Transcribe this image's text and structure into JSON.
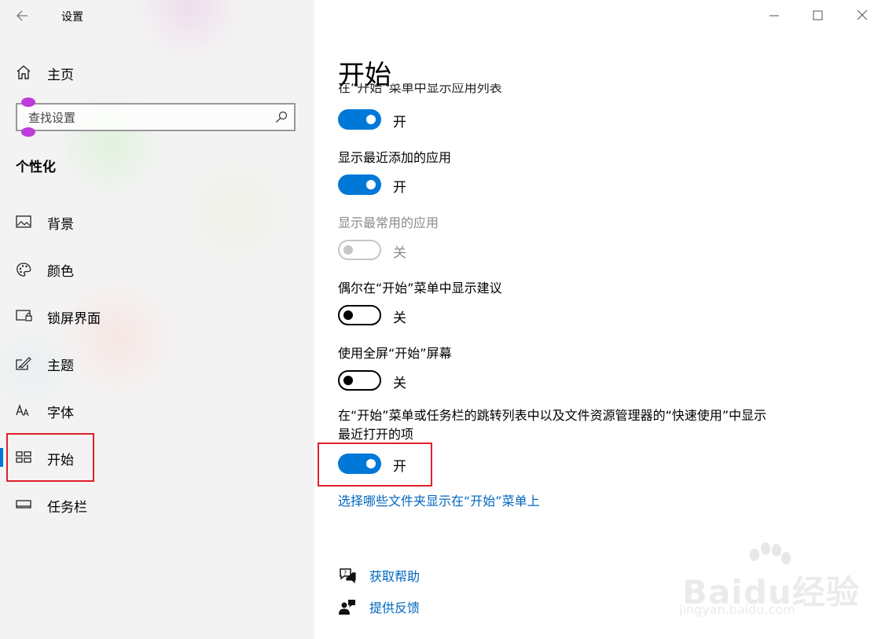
{
  "app": {
    "title": "设置"
  },
  "sidebar": {
    "home_label": "主页",
    "search_placeholder": "查找设置",
    "section_title": "个性化",
    "items": [
      {
        "label": "背景",
        "icon": "image-icon"
      },
      {
        "label": "颜色",
        "icon": "palette-icon"
      },
      {
        "label": "锁屏界面",
        "icon": "lock-screen-icon"
      },
      {
        "label": "主题",
        "icon": "theme-icon"
      },
      {
        "label": "字体",
        "icon": "font-icon"
      },
      {
        "label": "开始",
        "icon": "start-icon",
        "selected": true
      },
      {
        "label": "任务栏",
        "icon": "taskbar-icon"
      }
    ]
  },
  "main": {
    "title": "开始",
    "clipped_label": "在“开始”菜单中显示应用列表",
    "options": [
      {
        "label": "",
        "state": "开",
        "on": true,
        "enabled": true
      },
      {
        "label": "显示最近添加的应用",
        "state": "开",
        "on": true,
        "enabled": true
      },
      {
        "label": "显示最常用的应用",
        "state": "关",
        "on": false,
        "enabled": false
      },
      {
        "label": "偶尔在“开始”菜单中显示建议",
        "state": "关",
        "on": false,
        "enabled": true
      },
      {
        "label": "使用全屏“开始”屏幕",
        "state": "关",
        "on": false,
        "enabled": true
      },
      {
        "label": "在“开始”菜单或任务栏的跳转列表中以及文件资源管理器的“快速使用”中显示最近打开的项",
        "state": "开",
        "on": true,
        "enabled": true
      }
    ],
    "folders_link": "选择哪些文件夹显示在“开始”菜单上",
    "help_link": "获取帮助",
    "feedback_link": "提供反馈"
  },
  "watermark": {
    "brand": "Baidu经验",
    "url": "jingyan.baidu.com"
  },
  "colors": {
    "accent": "#0078d7",
    "link": "#0067c0",
    "highlight_box": "#e0202a"
  }
}
